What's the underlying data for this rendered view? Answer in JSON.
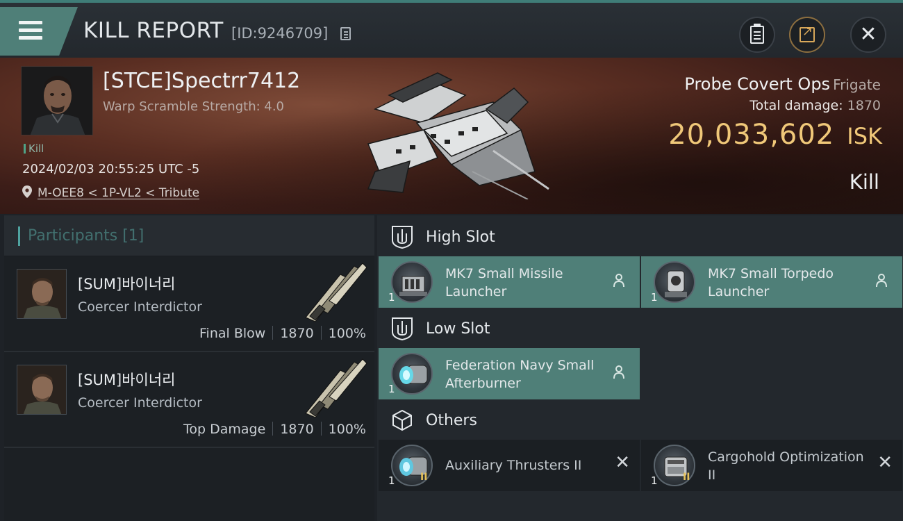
{
  "header": {
    "title": "KILL REPORT",
    "report_id": "[ID:9246709]"
  },
  "victim": {
    "name": "[STCE]Spectrr7412",
    "stat": "Warp Scramble Strength: 4.0",
    "tag": "Kill",
    "time": "2024/02/03 20:55:25 UTC -5",
    "location": "M-OEE8 < 1P-VL2 < Tribute"
  },
  "ship": {
    "name": "Probe Covert Ops",
    "class": "Frigate",
    "total_damage_label": "Total damage:",
    "total_damage": "1870",
    "isk_value": "20,033,602",
    "isk_unit": "ISK",
    "result": "Kill"
  },
  "participants": {
    "label": "Participants [1]",
    "items": [
      {
        "name": "[SUM]바이너리",
        "ship": "Coercer Interdictor",
        "role": "Final Blow",
        "damage": "1870",
        "percent": "100%"
      },
      {
        "name": "[SUM]바이너리",
        "ship": "Coercer Interdictor",
        "role": "Top Damage",
        "damage": "1870",
        "percent": "100%"
      }
    ]
  },
  "slots": {
    "high": {
      "label": "High Slot",
      "modules": [
        {
          "name": "MK7 Small Missile Launcher",
          "qty": "1"
        },
        {
          "name": "MK7 Small Torpedo Launcher",
          "qty": "1"
        }
      ]
    },
    "low": {
      "label": "Low Slot",
      "modules": [
        {
          "name": "Federation Navy Small Afterburner",
          "qty": "1"
        }
      ]
    },
    "others": {
      "label": "Others",
      "modules": [
        {
          "name": "Auxiliary Thrusters II",
          "qty": "1",
          "tech": "II"
        },
        {
          "name": "Cargohold Optimization II",
          "qty": "1",
          "tech": "II"
        }
      ]
    }
  },
  "colors": {
    "accent_teal": "#4f7f78",
    "isk_gold": "#f0c879",
    "kill_banner": "#5a2e22"
  }
}
